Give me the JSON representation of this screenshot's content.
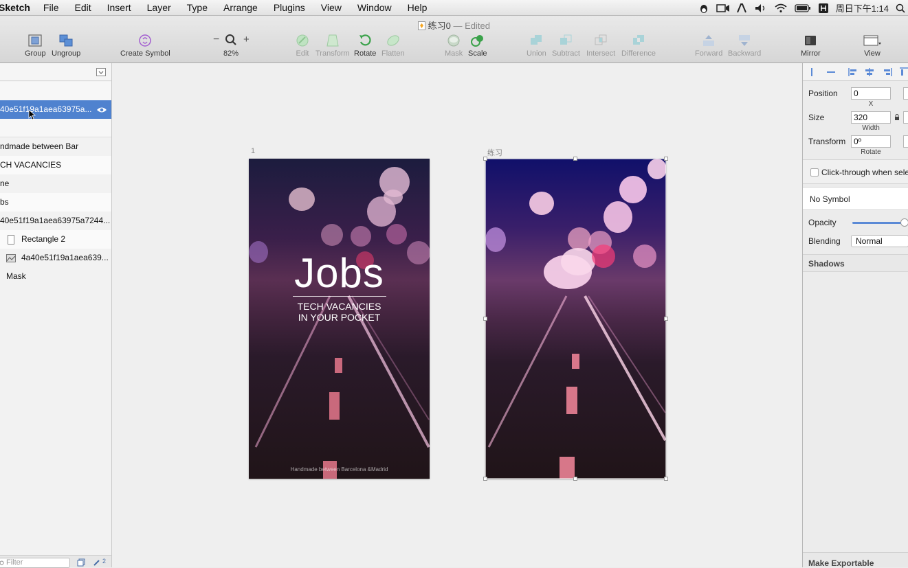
{
  "menubar": {
    "app": "Sketch",
    "items": [
      "File",
      "Edit",
      "Insert",
      "Layer",
      "Type",
      "Arrange",
      "Plugins",
      "View",
      "Window",
      "Help"
    ],
    "clock": "周日下午1:14"
  },
  "document": {
    "title": "练习0",
    "separator": "—",
    "status": "Edited"
  },
  "toolbar": {
    "group": "Group",
    "ungroup": "Ungroup",
    "create_symbol": "Create Symbol",
    "zoom_minus": "−",
    "zoom_plus": "+",
    "zoom": "82%",
    "edit": "Edit",
    "transform": "Transform",
    "rotate": "Rotate",
    "flatten": "Flatten",
    "mask": "Mask",
    "scale": "Scale",
    "union": "Union",
    "subtract": "Subtract",
    "intersect": "Intersect",
    "difference": "Difference",
    "forward": "Forward",
    "backward": "Backward",
    "mirror": "Mirror",
    "view": "View"
  },
  "layers": {
    "selected": "40e51f19a1aea63975a...",
    "items": [
      "ndmade between Bar",
      "CH VACANCIES",
      "ne",
      "bs",
      "40e51f19a1aea63975a7244...",
      "Rectangle 2",
      "4a40e51f19a1aea639...",
      "Mask"
    ],
    "filter_placeholder": "Filter",
    "page_count": "2"
  },
  "canvas": {
    "artboard1_label": "1",
    "artboard2_label": "练习",
    "jobs_title": "Jobs",
    "tagline_line1": "TECH VACANCIES",
    "tagline_line2": "IN YOUR POCKET",
    "footer": "Handmade between Barcelona &Madrid"
  },
  "inspector": {
    "position_label": "Position",
    "position_x": "0",
    "x_label": "X",
    "size_label": "Size",
    "width": "320",
    "width_label": "Width",
    "transform_label": "Transform",
    "rotate_value": "0º",
    "rotate_label": "Rotate",
    "click_through": "Click-through when sele",
    "symbol": "No Symbol",
    "opacity_label": "Opacity",
    "opacity_value": 1.0,
    "blending_label": "Blending",
    "blending_value": "Normal",
    "shadows": "Shadows",
    "make_exportable": "Make Exportable",
    "accent": "#4f82cf"
  }
}
